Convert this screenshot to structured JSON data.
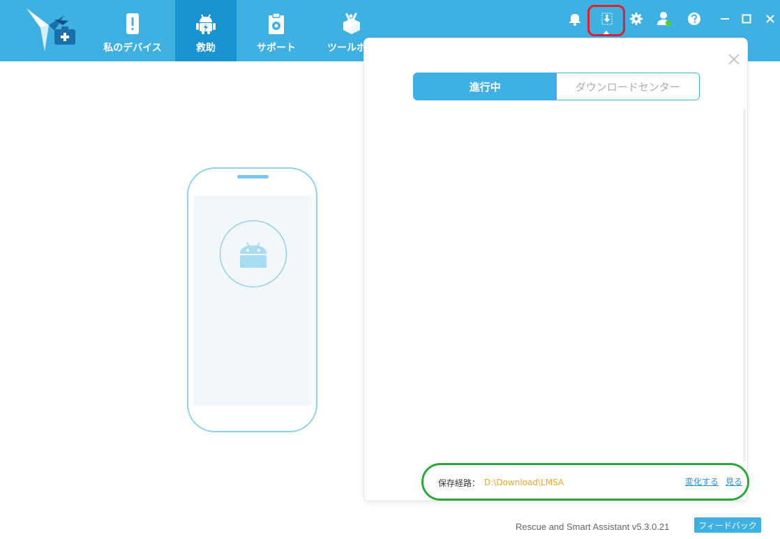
{
  "nav": {
    "tabs": [
      {
        "label": "私のデバイス",
        "icon": "phone-alert-icon"
      },
      {
        "label": "救助",
        "icon": "android-rescue-icon"
      },
      {
        "label": "サポート",
        "icon": "clipboard-support-icon"
      },
      {
        "label": "ツールボッ",
        "icon": "toolbox-icon"
      }
    ]
  },
  "toolbar_icons": [
    "bell-icon",
    "download-icon",
    "gear-icon",
    "user-icon",
    "help-icon"
  ],
  "window_controls": [
    "minimize-icon",
    "maximize-icon",
    "close-icon"
  ],
  "download_panel": {
    "tabs": {
      "in_progress": "進行中",
      "download_center": "ダウンロードセンター"
    },
    "save_path_label": "保存経路：",
    "save_path_value": "D:\\Download\\LMSA",
    "change_link": "変化する",
    "view_link": "見る"
  },
  "footer": {
    "version": "Rescue and Smart Assistant v5.3.0.21",
    "feedback": "フィードバック"
  },
  "colors": {
    "brand": "#3fb0e2",
    "brand_dark": "#1a93d1",
    "path_value": "#f5a623",
    "link": "#2a8fd0",
    "annotation_red": "#e0202a",
    "annotation_green": "#2aa63a"
  }
}
